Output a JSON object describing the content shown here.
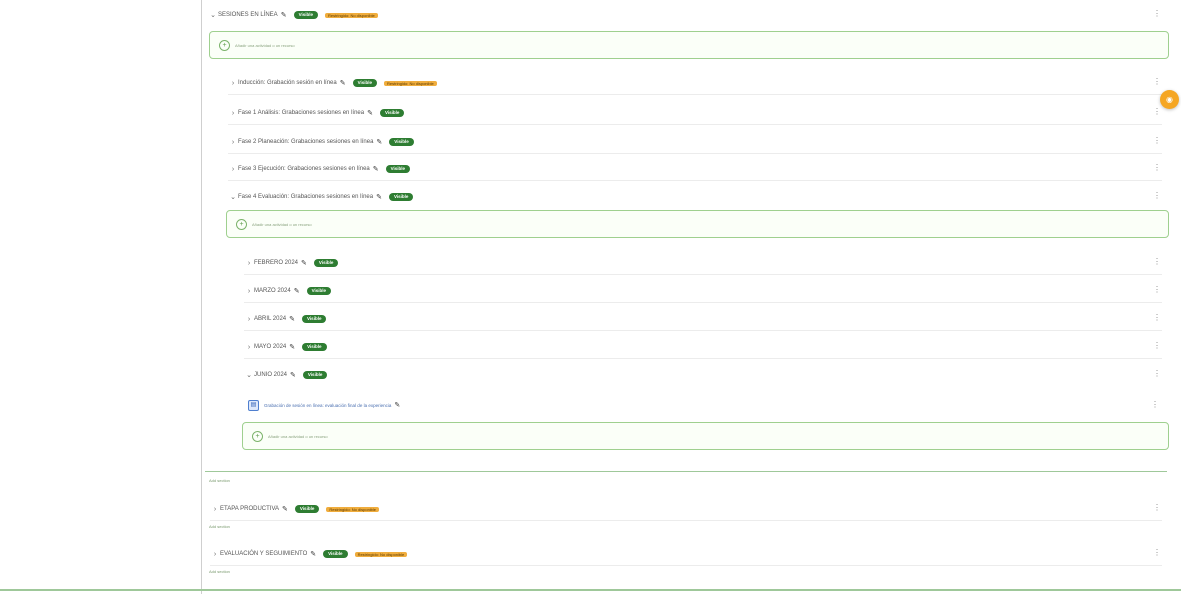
{
  "sections": {
    "root": {
      "chevron": "⌄",
      "title": "SESIONES EN LÍNEA",
      "badge": "Visible",
      "tag": "Restringido: No disponible"
    },
    "root_add": "Añadir una actividad o un recurso",
    "sub": [
      {
        "chevron": "›",
        "title": "Inducción: Grabación sesión en línea",
        "badge": "Visible",
        "tag": "Restringido: No disponible"
      },
      {
        "chevron": "›",
        "title": "Fase 1 Análisis: Grabaciones sesiones en línea",
        "badge": "Visible"
      },
      {
        "chevron": "›",
        "title": "Fase 2 Planeación: Grabaciones sesiones en línea",
        "badge": "Visible"
      },
      {
        "chevron": "›",
        "title": "Fase 3 Ejecución: Grabaciones sesiones en línea",
        "badge": "Visible"
      },
      {
        "chevron": "⌄",
        "title": "Fase 4 Evaluación: Grabaciones sesiones en línea",
        "badge": "Visible"
      }
    ],
    "fase4_add": "Añadir una actividad o un recurso",
    "months": [
      {
        "chevron": "›",
        "title": "FEBRERO 2024",
        "badge": "Visible"
      },
      {
        "chevron": "›",
        "title": "MARZO 2024",
        "badge": "Visible"
      },
      {
        "chevron": "›",
        "title": "ABRIL 2024",
        "badge": "Visible"
      },
      {
        "chevron": "›",
        "title": "MAYO 2024",
        "badge": "Visible"
      },
      {
        "chevron": "⌄",
        "title": "JUNIO 2024",
        "badge": "Visible"
      }
    ],
    "activity": {
      "icon": "▤",
      "title": "Grabación de sesión en línea: evaluación final de la experiencia"
    },
    "junio_add": "Añadir una actividad o un recurso",
    "add_section_1": "Add section",
    "etapa": {
      "chevron": "›",
      "title": "ETAPA PRODUCTIVA",
      "badge": "Visible",
      "tag": "Restringido: No disponible"
    },
    "add_section_2": "Add section",
    "evaluacion": {
      "chevron": "›",
      "title": "EVALUACIÓN Y SEGUIMIENTO",
      "badge": "Visible",
      "tag": "Restringido: No disponible"
    },
    "add_section_3": "Add section"
  },
  "icons": {
    "pencil": "✎",
    "kebab": "⋮",
    "plus": "+",
    "fab": "◉"
  },
  "colors": {
    "visible_badge": "#2e7d32",
    "restricted_tag": "#f0ad3d",
    "add_box_border": "#9fd08f",
    "fab": "#f5a623"
  }
}
